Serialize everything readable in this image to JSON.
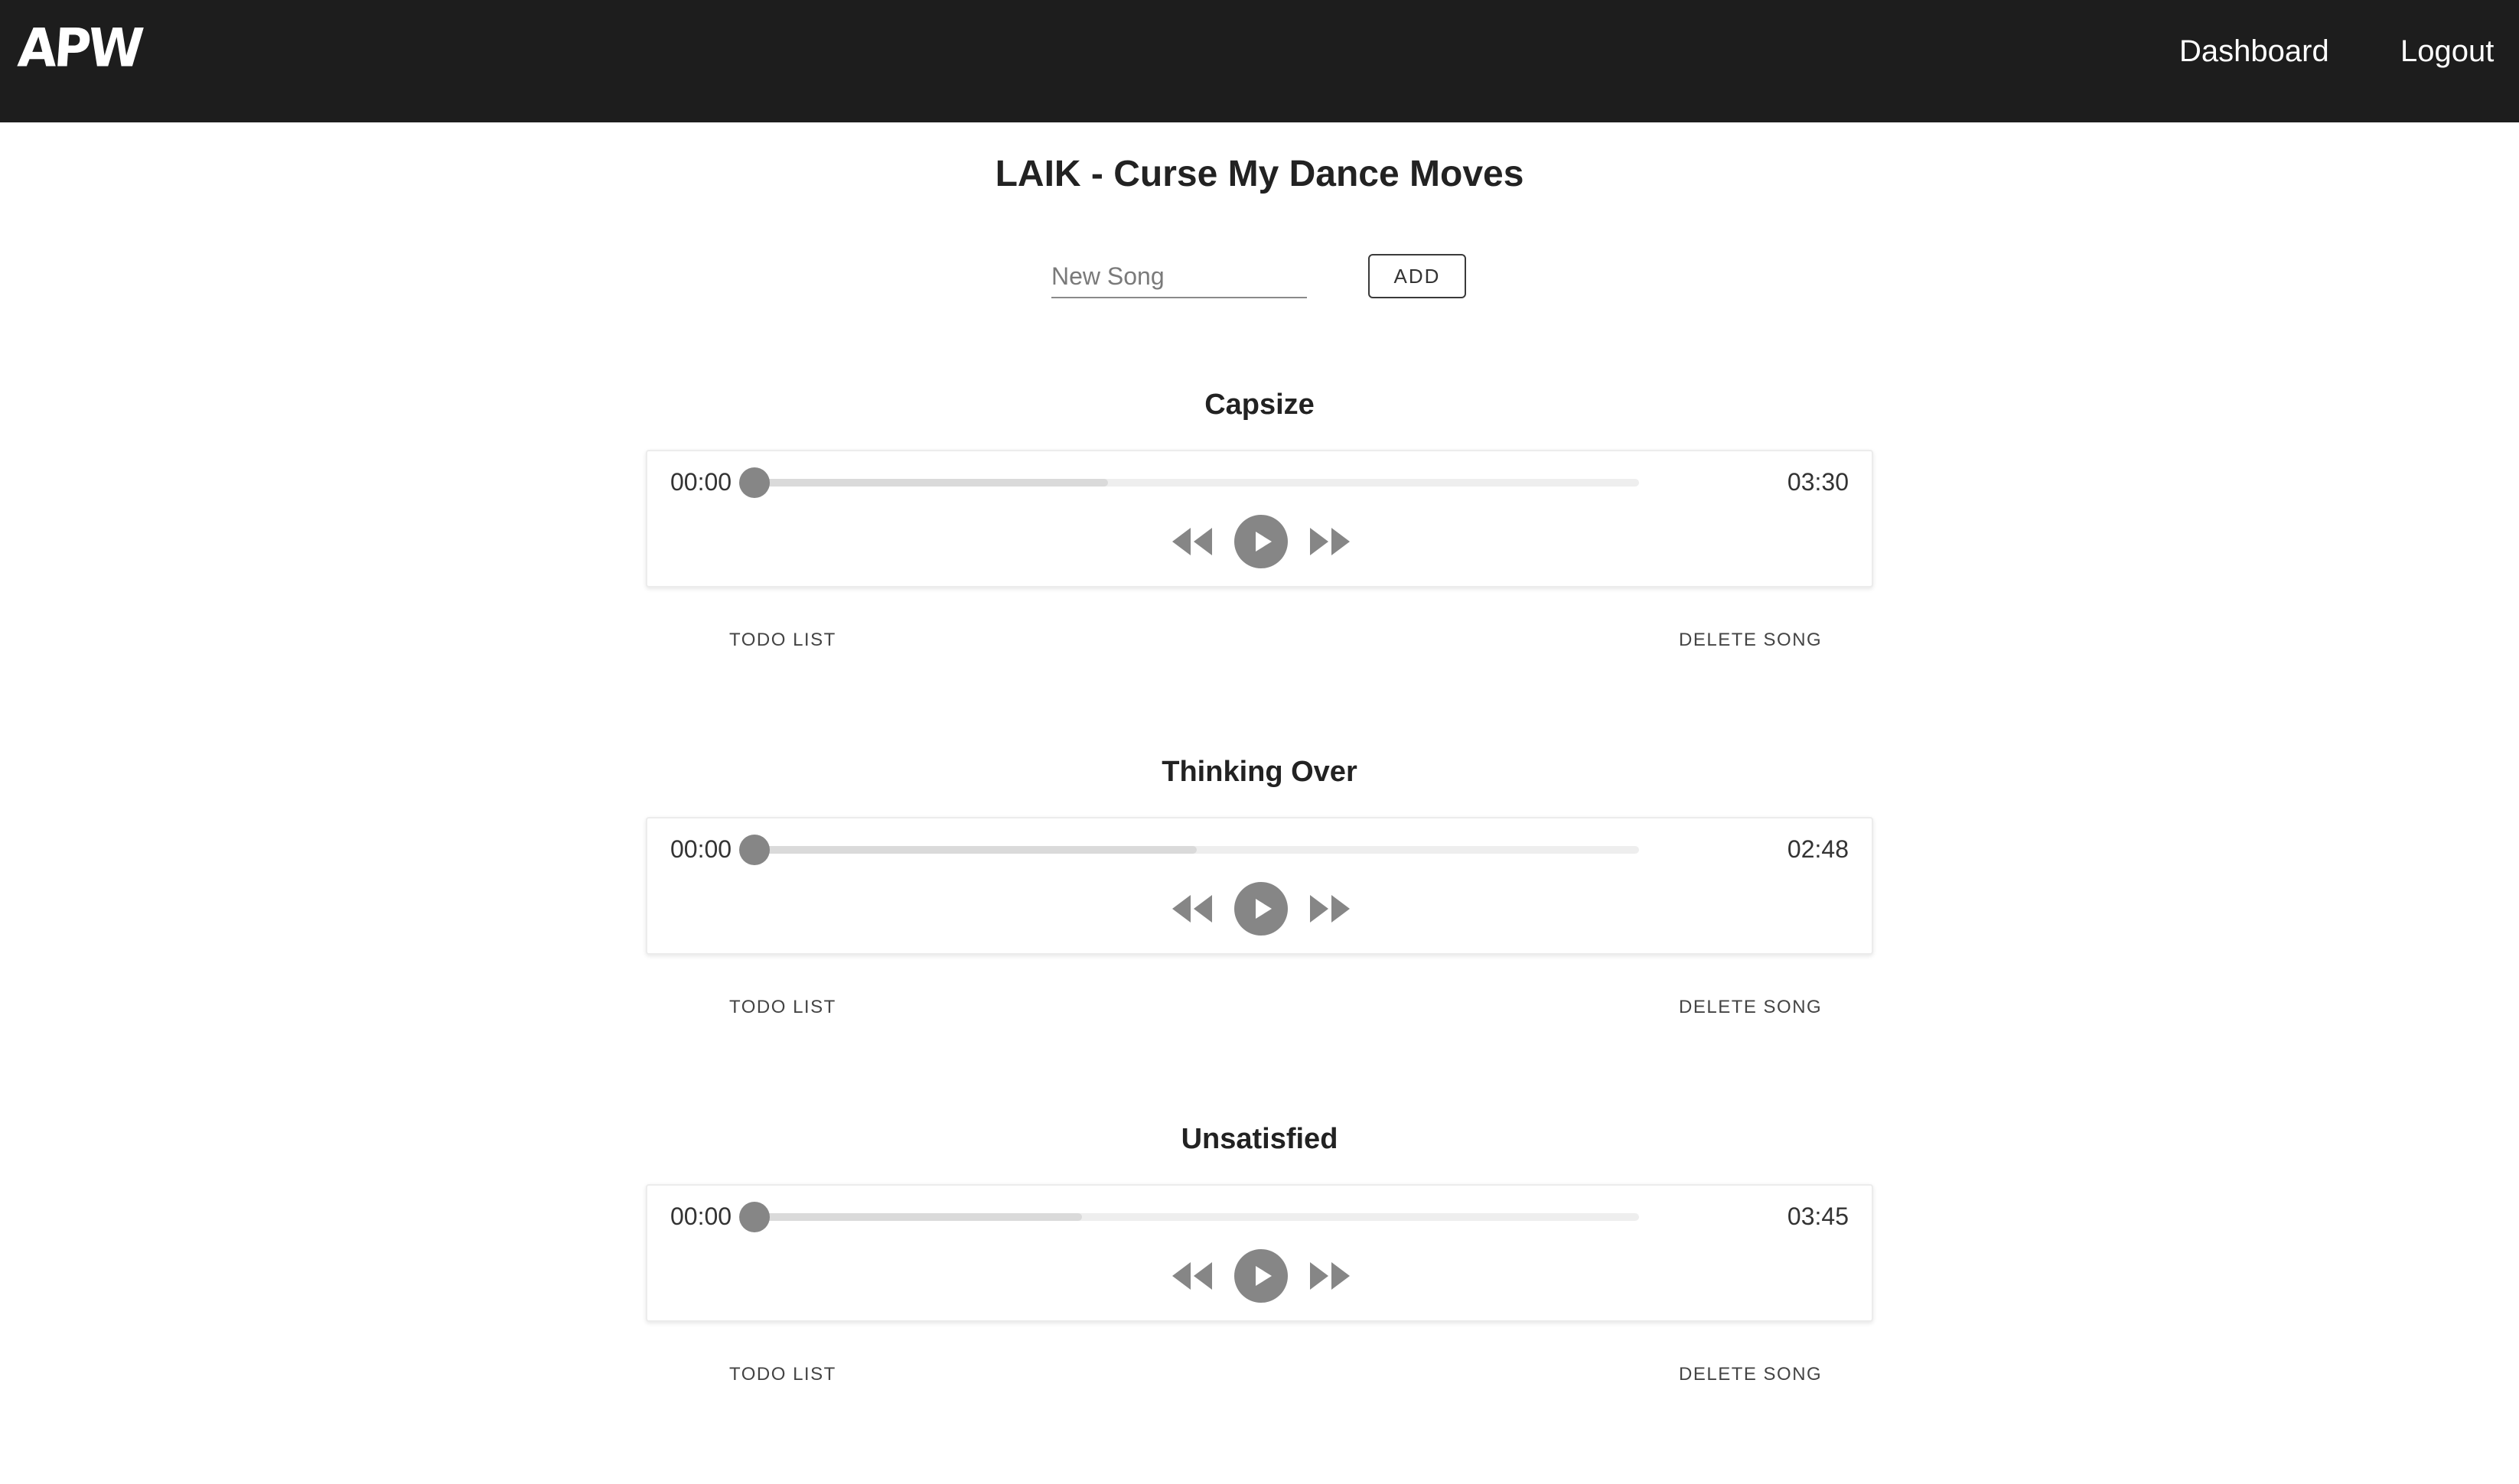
{
  "header": {
    "logo": "APW",
    "nav": {
      "dashboard": "Dashboard",
      "logout": "Logout"
    }
  },
  "page": {
    "title": "LAIK - Curse My Dance Moves"
  },
  "new_song": {
    "placeholder": "New Song",
    "value": "",
    "add_label": "ADD"
  },
  "songs": [
    {
      "title": "Capsize",
      "current_time": "00:00",
      "duration": "03:30",
      "progress": 0,
      "buffered": 0.4,
      "todo_label": "TODO LIST",
      "delete_label": "DELETE SONG"
    },
    {
      "title": "Thinking Over",
      "current_time": "00:00",
      "duration": "02:48",
      "progress": 0,
      "buffered": 0.5,
      "todo_label": "TODO LIST",
      "delete_label": "DELETE SONG"
    },
    {
      "title": "Unsatisfied",
      "current_time": "00:00",
      "duration": "03:45",
      "progress": 0,
      "buffered": 0.37,
      "todo_label": "TODO LIST",
      "delete_label": "DELETE SONG"
    }
  ],
  "icons": {
    "rewind": "rewind-icon",
    "play": "play-icon",
    "forward": "fast-forward-icon"
  },
  "colors": {
    "header_bg": "#1d1d1d",
    "header_text": "#ffffff",
    "control_gray": "#868686",
    "track_bg": "#eeeeee",
    "track_buffer": "#dadada"
  }
}
